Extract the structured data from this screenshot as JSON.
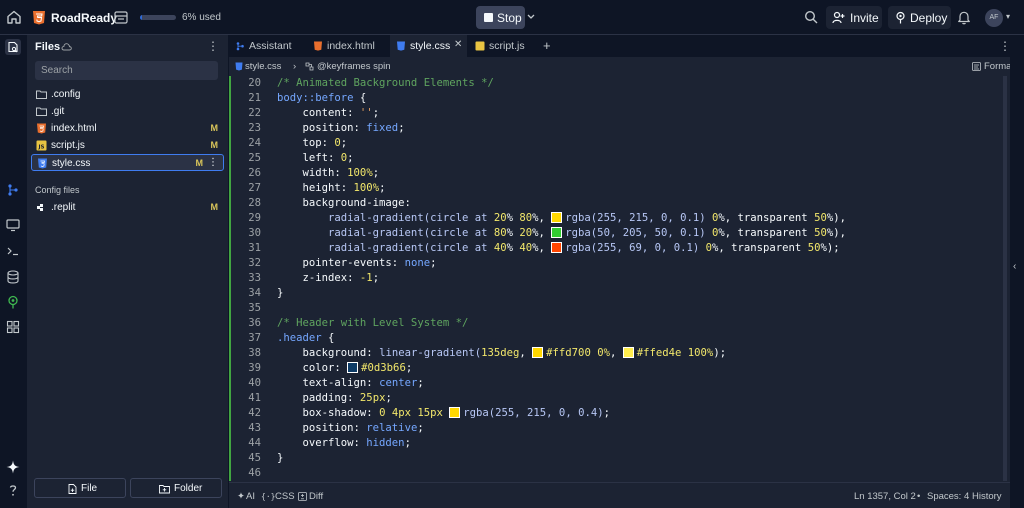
{
  "topbar": {
    "app_name": "RoadReady",
    "usage_text": "6% used",
    "usage_fraction": 0.06,
    "stop_label": "Stop",
    "invite_label": "Invite",
    "deploy_label": "Deploy",
    "avatar_initials": "AF",
    "accent_color": "#2f6ad8"
  },
  "files_panel": {
    "title": "Files",
    "search_placeholder": "Search",
    "items": [
      {
        "name": ".config",
        "icon": "folder-icon",
        "badge": ""
      },
      {
        "name": ".git",
        "icon": "folder-icon",
        "badge": ""
      },
      {
        "name": "index.html",
        "icon": "html-file-icon",
        "badge": "M"
      },
      {
        "name": "script.js",
        "icon": "js-file-icon",
        "badge": "M"
      },
      {
        "name": "style.css",
        "icon": "css-file-icon",
        "badge": "M"
      }
    ],
    "config_title": "Config files",
    "config_items": [
      {
        "name": ".replit",
        "icon": "replit-file-icon",
        "badge": "M"
      }
    ],
    "new_file_label": "File",
    "new_folder_label": "Folder"
  },
  "tabs": [
    {
      "label": "Assistant",
      "icon": "assistant-icon"
    },
    {
      "label": "index.html",
      "icon": "html-file-icon"
    },
    {
      "label": "style.css",
      "icon": "css-file-icon",
      "active": true
    },
    {
      "label": "script.js",
      "icon": "js-file-icon"
    }
  ],
  "breadcrumb": {
    "file": "style.css",
    "symbol": "@keyframes spin",
    "format_label": "Format"
  },
  "code": {
    "line_numbers": [
      "20",
      "21",
      "22",
      "23",
      "24",
      "25",
      "26",
      "27",
      "28",
      "29",
      "30",
      "31",
      "32",
      "33",
      "34",
      "35",
      "36",
      "37",
      "38",
      "39",
      "40",
      "41",
      "42",
      "43",
      "44",
      "45",
      "46"
    ],
    "l20": "/* Animated Background Elements */",
    "l21_sel": "body::before",
    "l21_rest": " {",
    "l22_prop": "    content: ",
    "l22_val": "''",
    "l22_end": ";",
    "l23_prop": "    position: ",
    "l23_val": "fixed",
    "l24_prop": "    top: ",
    "l24_val": "0",
    "l25_prop": "    left: ",
    "l25_val": "0",
    "l26_prop": "    width: ",
    "l26_num": "100",
    "l26_unit": "%",
    "l27_prop": "    height: ",
    "l27_num": "100",
    "l27_unit": "%",
    "l28_prop": "    background-image:",
    "l29_a": "        radial-gradient(circle at ",
    "l29_n1": "20",
    "l29_b": "% ",
    "l29_n2": "80",
    "l29_c": "%, ",
    "l29_fn": "rgba(255, 215, 0, 0.1) ",
    "l29_n3": "0",
    "l29_d": "%, transparent ",
    "l29_n4": "50",
    "l29_e": "%),",
    "l30_a": "        radial-gradient(circle at ",
    "l30_n1": "80",
    "l30_b": "% ",
    "l30_n2": "20",
    "l30_c": "%, ",
    "l30_fn": "rgba(50, 205, 50, 0.1) ",
    "l30_n3": "0",
    "l30_d": "%, transparent ",
    "l30_n4": "50",
    "l30_e": "%),",
    "l31_a": "        radial-gradient(circle at ",
    "l31_n1": "40",
    "l31_b": "% ",
    "l31_n2": "40",
    "l31_c": "%, ",
    "l31_fn": "rgba(255, 69, 0, 0.1) ",
    "l31_n3": "0",
    "l31_d": "%, transparent ",
    "l31_n4": "50",
    "l31_e": "%);",
    "l32_prop": "    pointer-events: ",
    "l32_val": "none",
    "l33_prop": "    z-index: ",
    "l33_val": "-1",
    "l34": "}",
    "l36": "/* Header with Level System */",
    "l37_sel": ".header",
    "l37_rest": " {",
    "l38_prop": "    background: ",
    "l38_fn": "linear-gradient(",
    "l38_n1": "135",
    "l38_u1": "deg",
    "l38_sep": ", ",
    "l38_c1": "#ffd700 ",
    "l38_n2": "0",
    "l38_u2": "%",
    "l38_sep2": ", ",
    "l38_c2": "#ffed4e ",
    "l38_n3": "100",
    "l38_u3": "%",
    "l38_end": ");",
    "l39_prop": "    color: ",
    "l39_val": "#0d3b66",
    "l40_prop": "    text-align: ",
    "l40_val": "center",
    "l41_prop": "    padding: ",
    "l41_num": "25",
    "l41_unit": "px",
    "l42_prop": "    box-shadow: ",
    "l42_n1": "0 4",
    "l42_u1": "px ",
    "l42_n2": "15",
    "l42_u2": "px",
    "l42_fn": "rgba(255, 215, 0, 0.4)",
    "l43_prop": "    position: ",
    "l43_val": "relative",
    "l44_prop": "    overflow: ",
    "l44_val": "hidden",
    "l45": "}",
    "swatches": {
      "gold": "#ffd700",
      "green": "#32cd32",
      "orange": "#ff4500",
      "gold_light": "#ffed4e",
      "navy": "#0d3b66"
    }
  },
  "statusbar": {
    "ai_label": "AI",
    "lang_label": "CSS",
    "diff_label": "Diff",
    "cursor": "Ln 1357, Col 2",
    "spaces": "Spaces: 4",
    "history": "History"
  }
}
